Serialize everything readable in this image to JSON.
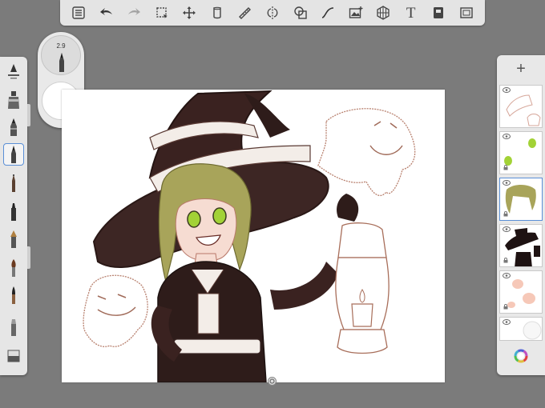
{
  "toolbar": {
    "items": [
      {
        "name": "layers-menu-icon",
        "enabled": true
      },
      {
        "name": "undo-icon",
        "enabled": true
      },
      {
        "name": "redo-icon",
        "enabled": false
      },
      {
        "name": "selection-icon",
        "enabled": true
      },
      {
        "name": "transform-icon",
        "enabled": true
      },
      {
        "name": "fill-icon",
        "enabled": true
      },
      {
        "name": "ruler-icon",
        "enabled": true
      },
      {
        "name": "symmetry-icon",
        "enabled": true
      },
      {
        "name": "shapes-icon",
        "enabled": true
      },
      {
        "name": "curve-icon",
        "enabled": true
      },
      {
        "name": "image-import-icon",
        "enabled": true
      },
      {
        "name": "perspective-grid-icon",
        "enabled": true
      },
      {
        "name": "text-icon",
        "enabled": true
      },
      {
        "name": "layer-options-icon",
        "enabled": true
      },
      {
        "name": "fullscreen-icon",
        "enabled": true
      }
    ],
    "text_tool_label": "T"
  },
  "brush_puck": {
    "size_value": "2.9"
  },
  "brush_palette": {
    "selected_index": 3,
    "brushes": [
      "fill-brush",
      "airbrush",
      "pencil",
      "fine-pencil",
      "ballpoint",
      "marker",
      "fountain-pen",
      "paintbrush",
      "ink-brush",
      "smudge",
      "eraser"
    ]
  },
  "layers_panel": {
    "add_label": "+",
    "selected_index": 2,
    "layers": [
      {
        "name": "layer-sketch",
        "visible": true
      },
      {
        "name": "layer-eyes",
        "visible": true
      },
      {
        "name": "layer-hair",
        "visible": true
      },
      {
        "name": "layer-outfit",
        "visible": true
      },
      {
        "name": "layer-skin",
        "visible": true
      },
      {
        "name": "layer-background",
        "visible": true
      }
    ]
  },
  "colors": {
    "ui_background": "#7b7b7b",
    "selection_blue": "#5a8fd6",
    "ink_dark": "#2e1c1a",
    "outline_brown": "#a86e5a",
    "hair_olive": "#a8a45a",
    "eye_green": "#a2d236",
    "skin": "#f6dcd2"
  }
}
